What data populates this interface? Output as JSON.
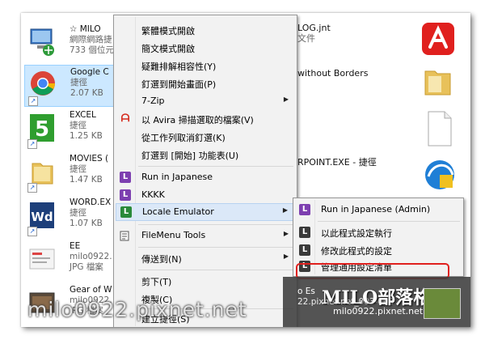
{
  "files_left": [
    {
      "l1": "☆ MILO",
      "l2": "網際網路捷",
      "l3": "733 個位元"
    },
    {
      "l1": "Google C",
      "l2": "捷徑",
      "l3": "2.07 KB"
    },
    {
      "l1": "EXCEL",
      "l2": "捷徑",
      "l3": "1.25 KB"
    },
    {
      "l1": "MOVIES (",
      "l2": "捷徑",
      "l3": "1.47 KB"
    },
    {
      "l1": "WORD.EX",
      "l2": "捷徑",
      "l3": "1.07 KB"
    },
    {
      "l1": "EE",
      "l2": "milo0922.",
      "l3": "JPG 檔案"
    },
    {
      "l1": "Gear of W",
      "l2": "milo0922.",
      "l3": "JPG 檔案"
    }
  ],
  "files_mid": [
    {
      "l1": "LOG.jnt",
      "l2": "文件"
    },
    {
      "l1": "without Borders",
      "l2": ""
    },
    {
      "l1": "RPOINT.EXE - 捷徑",
      "l2": ""
    },
    {
      "l1": "o Es",
      "l2": "22.pixnet.net_003-003"
    }
  ],
  "context_menu": [
    {
      "label": "繁體模式開啟"
    },
    {
      "label": "簡文模式開啟"
    },
    {
      "label": "疑難排解相容性(Y)"
    },
    {
      "label": "釘選到開始畫面(P)"
    },
    {
      "label": "7-Zip"
    },
    {
      "label": "以 Avira 掃描選取的檔案(V)"
    },
    {
      "label": "從工作列取消釘選(K)"
    },
    {
      "label": "釘選到 [開始] 功能表(U)"
    },
    {
      "label": "Run in Japanese"
    },
    {
      "label": "KKKK"
    },
    {
      "label": "Locale Emulator"
    },
    {
      "label": "FileMenu Tools"
    },
    {
      "label": "傳送到(N)"
    },
    {
      "label": "剪下(T)"
    },
    {
      "label": "複製(C)"
    },
    {
      "label": "建立捷徑(S)"
    }
  ],
  "submenu": [
    {
      "label": "Run in Japanese (Admin)"
    },
    {
      "label": "以此程式設定執行"
    },
    {
      "label": "修改此程式的設定"
    },
    {
      "label": "管理通用設定清單"
    }
  ],
  "icons": {
    "submenu_arrow": "▶",
    "avira_logo": "ᗩ",
    "le": "L",
    "shortcut_arrow": "↗"
  },
  "watermark": {
    "main": "milo0922.pixnet.net",
    "brand": "MILO部落格",
    "brand_url": "milo0922.pixnet.net"
  },
  "colors": {
    "highlight": "#dbe8f8",
    "selection": "#cce8ff",
    "callout": "#e0201e",
    "le_purple": "#7d3fb0"
  }
}
